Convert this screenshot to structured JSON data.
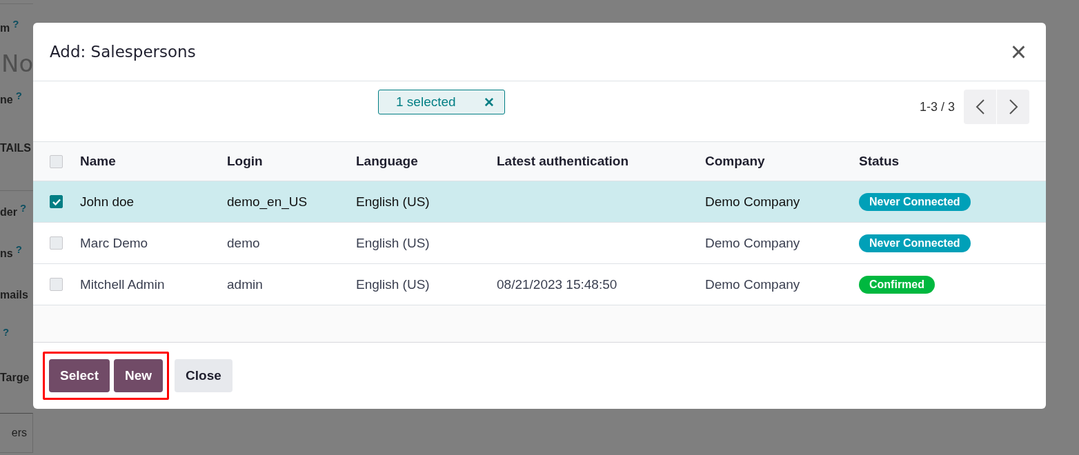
{
  "background_form": {
    "labels": [
      {
        "text": "m",
        "help": true,
        "kind": "label"
      },
      {
        "text": "No",
        "help": false,
        "kind": "title"
      },
      {
        "text": "ne",
        "help": true,
        "kind": "label"
      },
      {
        "text": "TAILS",
        "help": false,
        "kind": "section"
      },
      {
        "text": "der",
        "help": true,
        "kind": "label"
      },
      {
        "text": "ns",
        "help": true,
        "kind": "label"
      },
      {
        "text": "mails",
        "help": false,
        "kind": "label"
      },
      {
        "help": true,
        "kind": "label"
      },
      {
        "text": "Targe",
        "help": false,
        "kind": "label"
      },
      {
        "text": "ers",
        "help": false,
        "kind": "tab"
      }
    ],
    "help_mark": "?"
  },
  "dialog": {
    "title": "Add: Salespersons",
    "close_icon": "×",
    "selection_badge": {
      "label": "1 selected",
      "clear": "✕"
    },
    "pager": {
      "range": "1-3 / 3"
    },
    "table": {
      "select_all_checked": false,
      "columns": [
        "Name",
        "Login",
        "Language",
        "Latest authentication",
        "Company",
        "Status"
      ],
      "rows": [
        {
          "selected": true,
          "checked": true,
          "cells": [
            "John doe",
            "demo_en_US",
            "English (US)",
            "",
            "Demo Company"
          ],
          "status": {
            "label": "Never Connected",
            "color": "#00a0b8"
          }
        },
        {
          "selected": false,
          "checked": false,
          "cells": [
            "Marc Demo",
            "demo",
            "English (US)",
            "",
            "Demo Company"
          ],
          "status": {
            "label": "Never Connected",
            "color": "#00a0b8"
          }
        },
        {
          "selected": false,
          "checked": false,
          "cells": [
            "Mitchell Admin",
            "admin",
            "English (US)",
            "08/21/2023 15:48:50",
            "Demo Company"
          ],
          "status": {
            "label": "Confirmed",
            "color": "#00b83f"
          }
        }
      ]
    },
    "buttons": [
      {
        "label": "Select",
        "kind": "primary",
        "highlighted": true
      },
      {
        "label": "New",
        "kind": "primary",
        "highlighted": true
      },
      {
        "label": "Close",
        "kind": "secondary",
        "highlighted": false
      }
    ]
  }
}
